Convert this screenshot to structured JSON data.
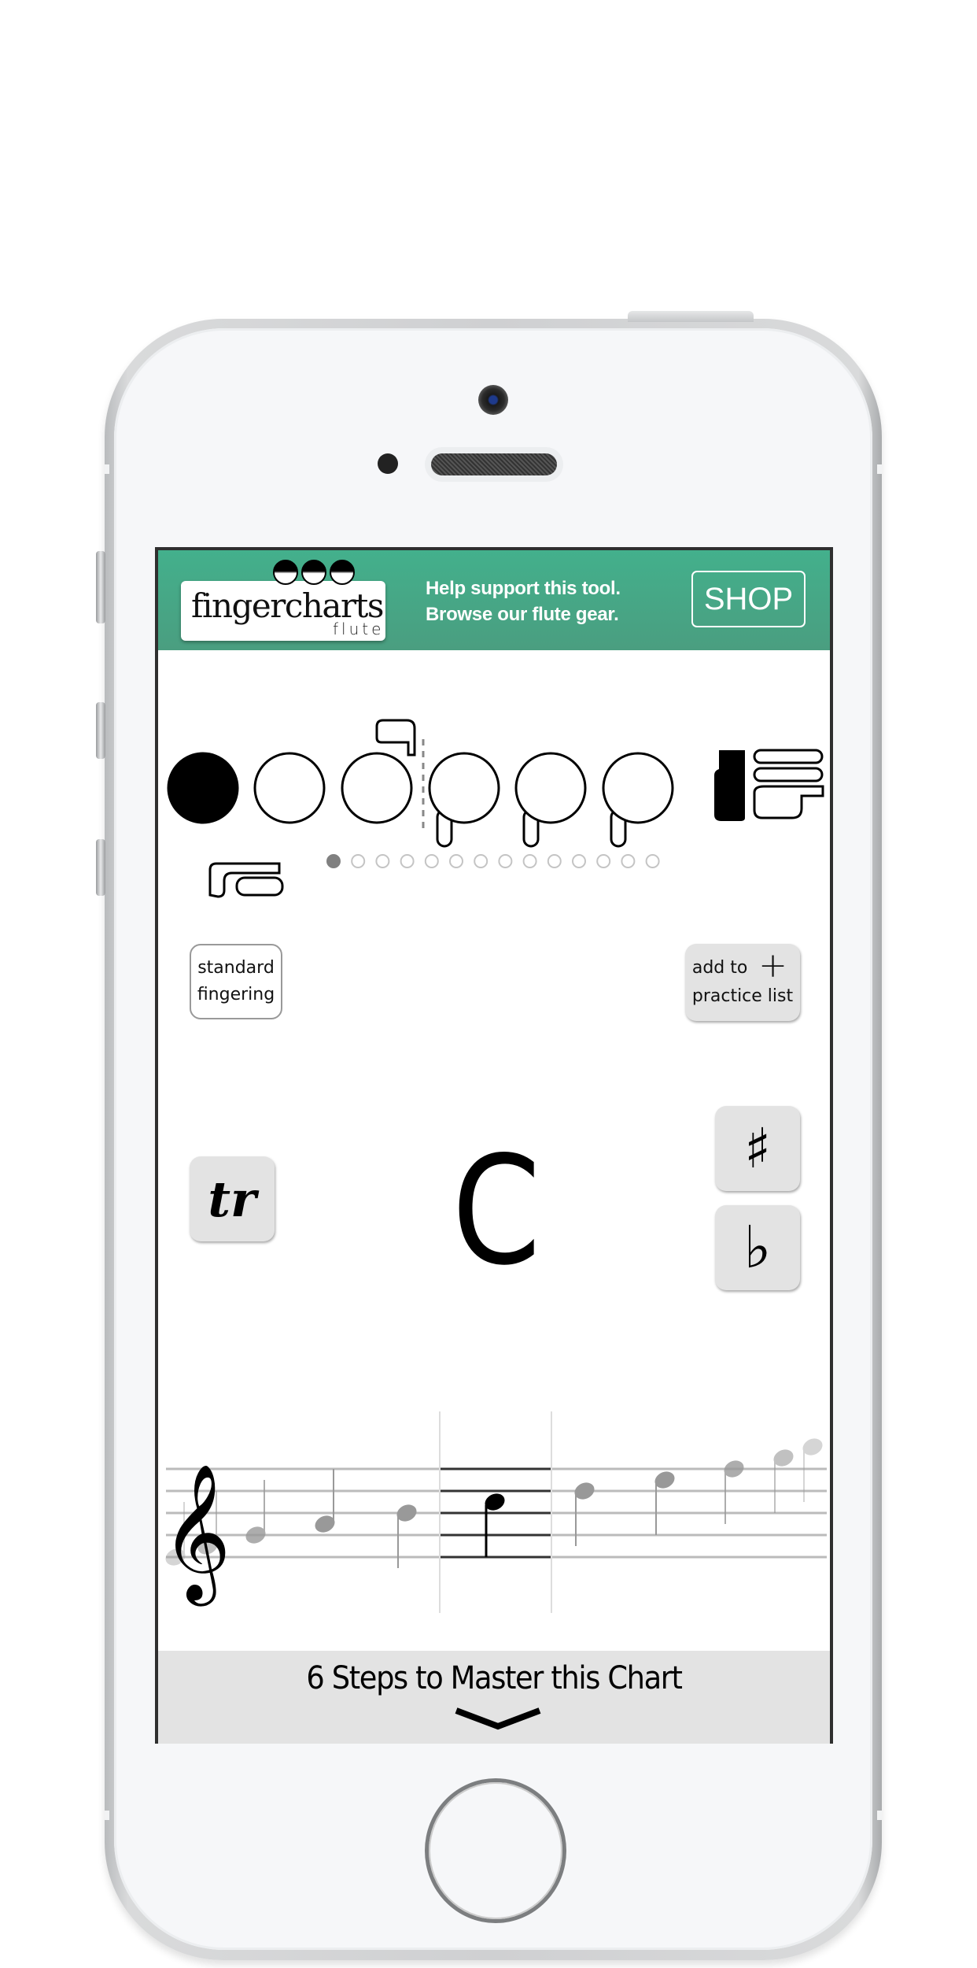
{
  "banner": {
    "logo_text": "fingercharts",
    "logo_sub": "flute",
    "promo_line1": "Help support this tool.",
    "promo_line2": "Browse our flute gear.",
    "shop_label": "SHOP",
    "brand_color": "#43b08c"
  },
  "fingering": {
    "keys": [
      {
        "name": "thumb-key",
        "closed": true
      },
      {
        "name": "left-index-key",
        "closed": false
      },
      {
        "name": "left-middle-key",
        "closed": false
      },
      {
        "name": "right-index-key",
        "closed": false
      },
      {
        "name": "right-middle-key",
        "closed": false
      },
      {
        "name": "right-ring-key",
        "closed": false
      }
    ],
    "pinky_key_closed": true,
    "alternate_count": 14,
    "alternate_selected": 1
  },
  "controls": {
    "standard_line1": "standard",
    "standard_line2": "fingering",
    "add_line1": "add to",
    "add_line2": "practice list",
    "add_icon": "+",
    "trill_label": "tr",
    "sharp_label": "♯",
    "flat_label": "♭"
  },
  "note": {
    "name": "C",
    "staff_notes": [
      "E4",
      "F4",
      "G4",
      "A4",
      "B4",
      "C5",
      "D5",
      "E5",
      "F5",
      "G5",
      "A5"
    ],
    "selected_index": 5
  },
  "footer": {
    "steps_label": "6 Steps to Master this Chart",
    "chevron_icon": "chevron-down-icon"
  }
}
